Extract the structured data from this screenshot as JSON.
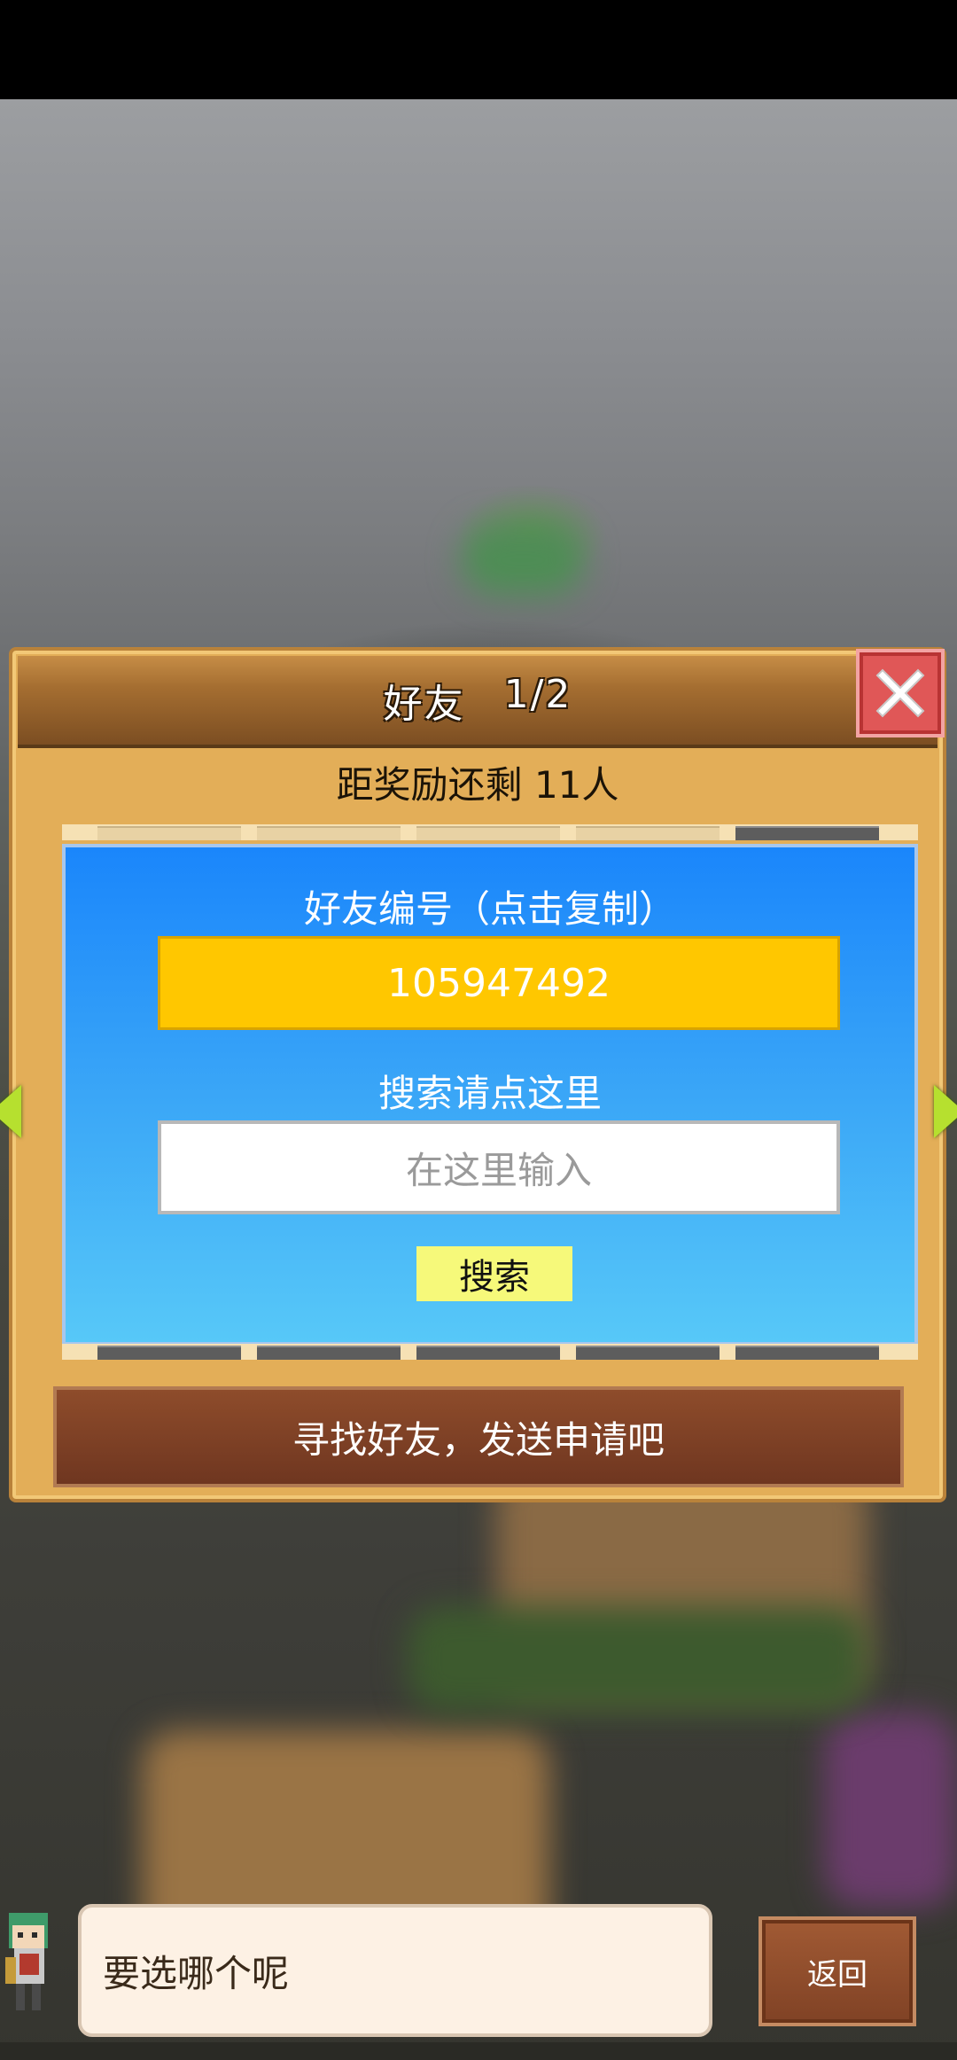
{
  "dialog": {
    "title": "好友",
    "page": "1/2",
    "reward_text": "距奖励还剩 11人"
  },
  "friend_panel": {
    "friend_id_label": "好友编号（点击复制）",
    "friend_id": "105947492",
    "search_label": "搜索请点这里",
    "search_placeholder": "在这里输入",
    "search_button": "搜索"
  },
  "bottom_banner": "寻找好友，发送申请吧",
  "message_bar": {
    "speech": "要选哪个呢",
    "back_button": "返回"
  },
  "colors": {
    "panel_wood": "#e3ae58",
    "header_brown": "#7c4e22",
    "close_red": "#e05757",
    "id_yellow": "#ffc700",
    "blue_top": "#1a86fb",
    "blue_bottom": "#57c8f8",
    "arrow_green": "#b6e02f",
    "banner_brown": "#7a3d24"
  },
  "icons": [
    "close-icon",
    "arrow-left-icon",
    "arrow-right-icon",
    "character-avatar"
  ]
}
